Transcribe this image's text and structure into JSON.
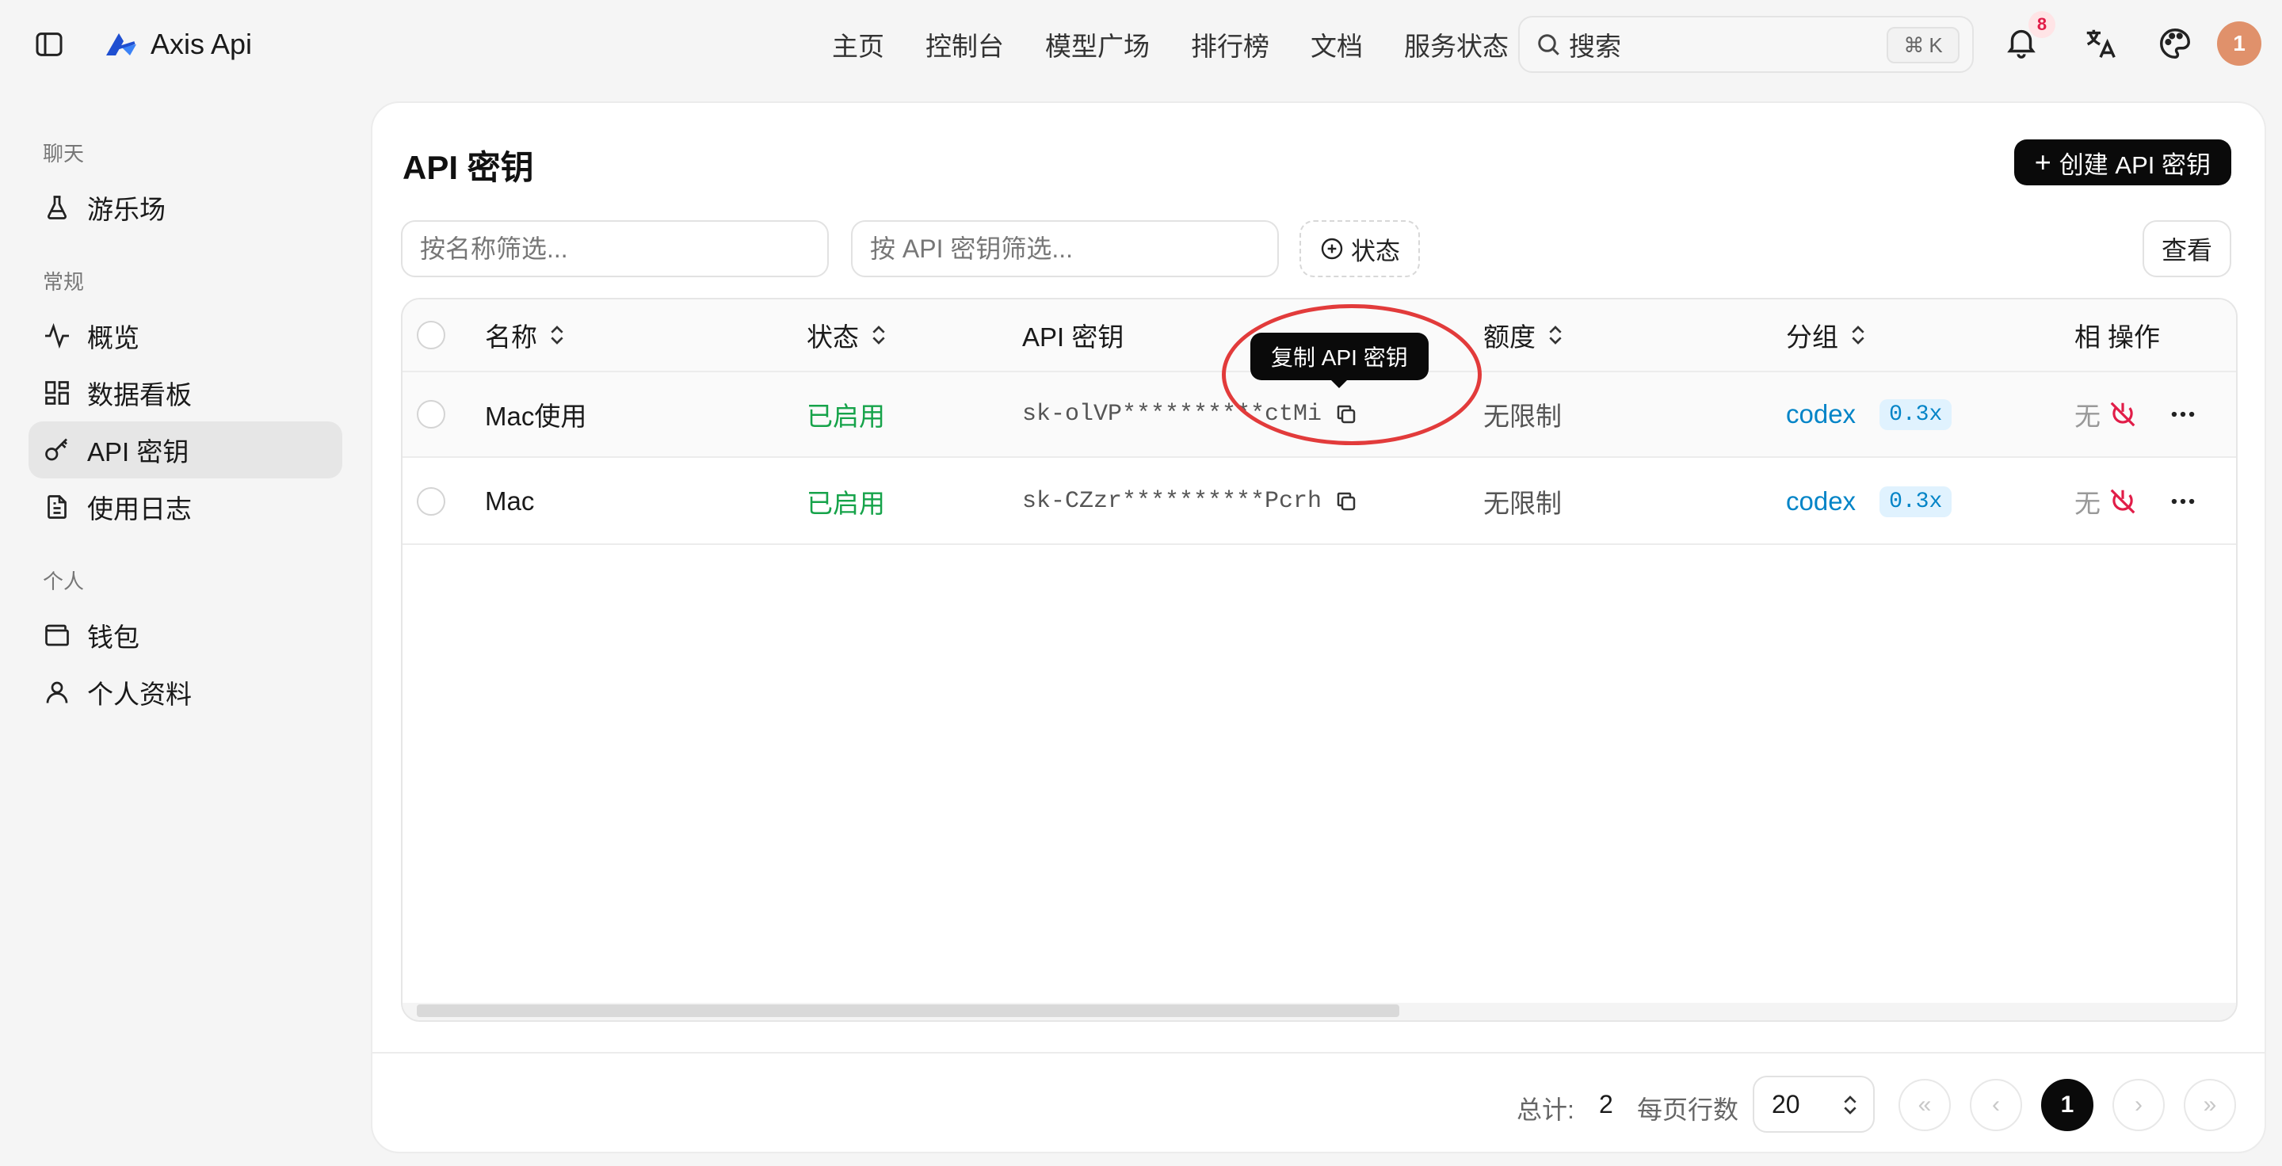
{
  "app": {
    "name": "Axis Api"
  },
  "nav": {
    "items": [
      "主页",
      "控制台",
      "模型广场",
      "排行榜",
      "文档",
      "服务状态"
    ]
  },
  "search": {
    "label": "搜索",
    "shortcut_symbol": "⌘",
    "shortcut_key": "K"
  },
  "notifications": {
    "count": "8"
  },
  "user": {
    "avatar_initial": "1",
    "avatar_color": "#e0916b"
  },
  "sidebar": {
    "groups": {
      "chat": "聊天",
      "general": "常规",
      "personal": "个人"
    },
    "items": {
      "playground": "游乐场",
      "overview": "概览",
      "dashboard": "数据看板",
      "api_keys": "API 密钥",
      "usage_logs": "使用日志",
      "wallet": "钱包",
      "profile": "个人资料"
    },
    "active": "api_keys"
  },
  "page": {
    "title": "API 密钥",
    "create_button": "创建 API 密钥",
    "filter_name_placeholder": "按名称筛选...",
    "filter_key_placeholder": "按 API 密钥筛选...",
    "status_filter": "状态",
    "view_button": "查看"
  },
  "table": {
    "columns": {
      "name": "名称",
      "status": "状态",
      "key": "API 密钥",
      "quota": "额度",
      "group": "分组",
      "extra": "相",
      "ops": "操作"
    },
    "rows": [
      {
        "name": "Mac使用",
        "status": "已启用",
        "key": "sk-olVP**********ctMi",
        "quota": "无限制",
        "group": "codex",
        "ratio": "0.3x",
        "extra": "无"
      },
      {
        "name": "Mac",
        "status": "已启用",
        "key": "sk-CZzr**********Pcrh",
        "quota": "无限制",
        "group": "codex",
        "ratio": "0.3x",
        "extra": "无"
      }
    ]
  },
  "tooltip": {
    "text": "复制 API 密钥"
  },
  "pagination": {
    "total_label": "总计:",
    "total_value": "2",
    "rows_per_page_label": "每页行数",
    "rows_per_page": "20",
    "current_page": "1"
  },
  "colors": {
    "enabled_green": "#16a34a",
    "link_blue": "#0284c7",
    "highlight_red": "#e23b3b",
    "primary_black": "#0a0a0a"
  }
}
